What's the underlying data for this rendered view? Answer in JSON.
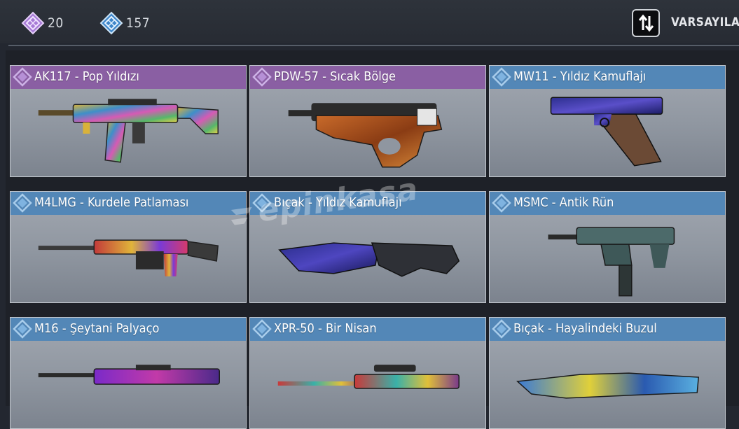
{
  "currency": {
    "purple_amount": "20",
    "purple_icon": "purple-diamond-icon",
    "blue_amount": "157",
    "blue_icon": "blue-diamond-icon"
  },
  "sort": {
    "icon": "sort-arrows-icon",
    "label": "VARSAYILAN"
  },
  "watermark": "epinkasa",
  "items": [
    {
      "title": "AK117 - Pop Yıldızı",
      "rarity": "purple"
    },
    {
      "title": "PDW-57 - Sıcak Bölge",
      "rarity": "purple"
    },
    {
      "title": "MW11 - Yıldız Kamuflajı",
      "rarity": "blue"
    },
    {
      "title": "M4LMG - Kurdele Patlaması",
      "rarity": "blue"
    },
    {
      "title": "Bıçak - Yıldız Kamuflajı",
      "rarity": "blue"
    },
    {
      "title": "MSMC - Antik Rün",
      "rarity": "blue"
    },
    {
      "title": "M16 - Şeytani Palyaço",
      "rarity": "blue"
    },
    {
      "title": "XPR-50 - Bir Nisan",
      "rarity": "blue"
    },
    {
      "title": "Bıçak - Hayalindeki Buzul",
      "rarity": "blue"
    }
  ],
  "colors": {
    "purple_header": "#8a5fa3",
    "blue_header": "#5387b7",
    "background": "#232730"
  }
}
